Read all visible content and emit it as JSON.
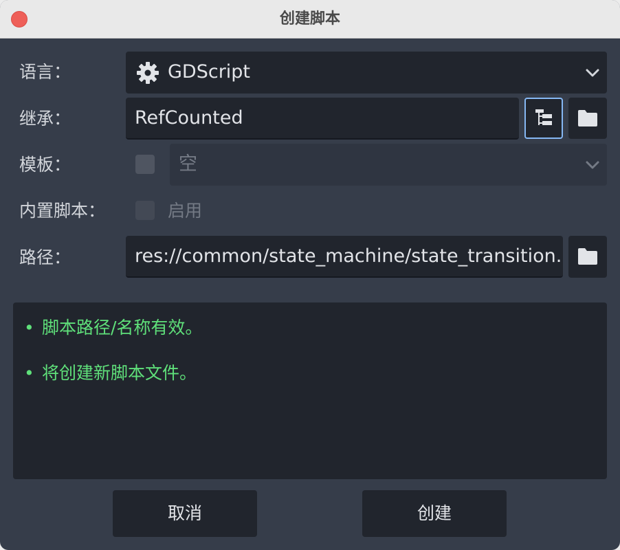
{
  "window": {
    "title": "创建脚本"
  },
  "form": {
    "language": {
      "label": "语言：",
      "value": "GDScript",
      "icon": "gear-icon"
    },
    "inherits": {
      "label": "继承：",
      "value": "RefCounted"
    },
    "template": {
      "label": "模板：",
      "value": "空",
      "checked": false
    },
    "builtin_script": {
      "label": "内置脚本：",
      "checkbox_label": "启用",
      "checked": false
    },
    "path": {
      "label": "路径：",
      "value": "res://common/state_machine/state_transition."
    }
  },
  "status": {
    "bullet": "•",
    "lines": [
      "脚本路径/名称有效。",
      "将创建新脚本文件。"
    ],
    "color": "#5fe07a"
  },
  "buttons": {
    "cancel": "取消",
    "create": "创建"
  },
  "colors": {
    "accent_focus": "#86b8f4",
    "panel_bg": "#363d4a",
    "field_bg": "#21252d"
  }
}
